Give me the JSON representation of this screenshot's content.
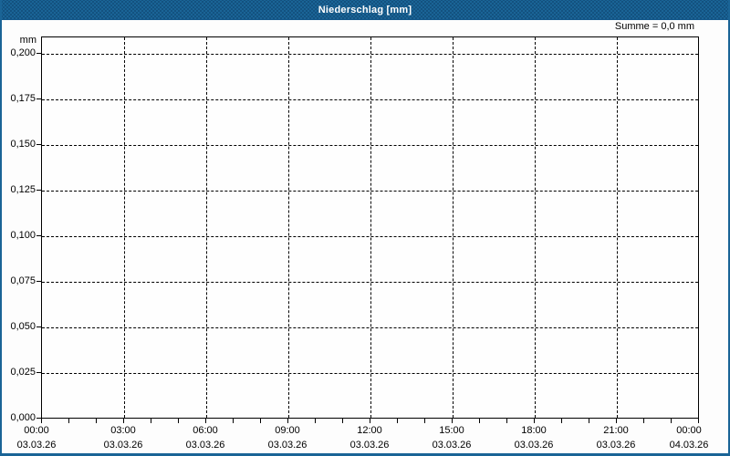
{
  "window": {
    "title": "Niederschlag [mm]",
    "summary": "Summe = 0,0 mm",
    "unit_label": "mm",
    "colors": {
      "titlebar": "#1a6496",
      "titlebar_dot": "#063056",
      "frame_border": "#1a6496",
      "title_text": "#ffffff",
      "axis": "#000000",
      "grid": "#000000",
      "text": "#000000",
      "plot_background": "#fefefe"
    }
  },
  "chart_data": {
    "type": "line",
    "title": "Niederschlag [mm]",
    "subtitle": "",
    "xlabel": "",
    "ylabel": "mm",
    "annotation": "Summe = 0,0 mm",
    "ylim": [
      0,
      0.209
    ],
    "y_tick_values": [
      0.2,
      0.175,
      0.15,
      0.125,
      0.1,
      0.075,
      0.05,
      0.025,
      0.0
    ],
    "y_tick_labels": [
      "0,200",
      "0,175",
      "0,150",
      "0,125",
      "0,100",
      "0,075",
      "0,050",
      "0,025",
      "0,000"
    ],
    "x_major_ticks": [
      {
        "time": "00:00",
        "date": "03.03.26"
      },
      {
        "time": "03:00",
        "date": "03.03.26"
      },
      {
        "time": "06:00",
        "date": "03.03.26"
      },
      {
        "time": "09:00",
        "date": "03.03.26"
      },
      {
        "time": "12:00",
        "date": "03.03.26"
      },
      {
        "time": "15:00",
        "date": "03.03.26"
      },
      {
        "time": "18:00",
        "date": "03.03.26"
      },
      {
        "time": "21:00",
        "date": "03.03.26"
      },
      {
        "time": "00:00",
        "date": "04.03.26"
      }
    ],
    "x_minor_tick_interval_hours": 1,
    "x_major_tick_interval_hours": 3,
    "x_range_hours": 24,
    "grid": {
      "style": "dashed",
      "horizontal": true,
      "vertical": true
    },
    "legend": "none",
    "series": [
      {
        "name": "Niederschlag",
        "values": [],
        "note": "no precipitation recorded, sum = 0,0 mm"
      }
    ]
  }
}
